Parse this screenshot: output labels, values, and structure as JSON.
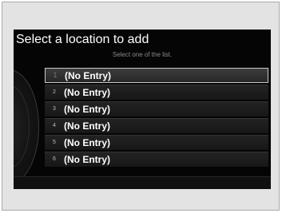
{
  "screen": {
    "title": "Select a location to add",
    "subtitle": "Select one of the list."
  },
  "list": {
    "items": [
      {
        "number": "1",
        "label": "(No Entry)",
        "selected": true
      },
      {
        "number": "2",
        "label": "(No Entry)",
        "selected": false
      },
      {
        "number": "3",
        "label": "(No Entry)",
        "selected": false
      },
      {
        "number": "4",
        "label": "(No Entry)",
        "selected": false
      },
      {
        "number": "5",
        "label": "(No Entry)",
        "selected": false
      },
      {
        "number": "6",
        "label": "(No Entry)",
        "selected": false
      }
    ]
  }
}
